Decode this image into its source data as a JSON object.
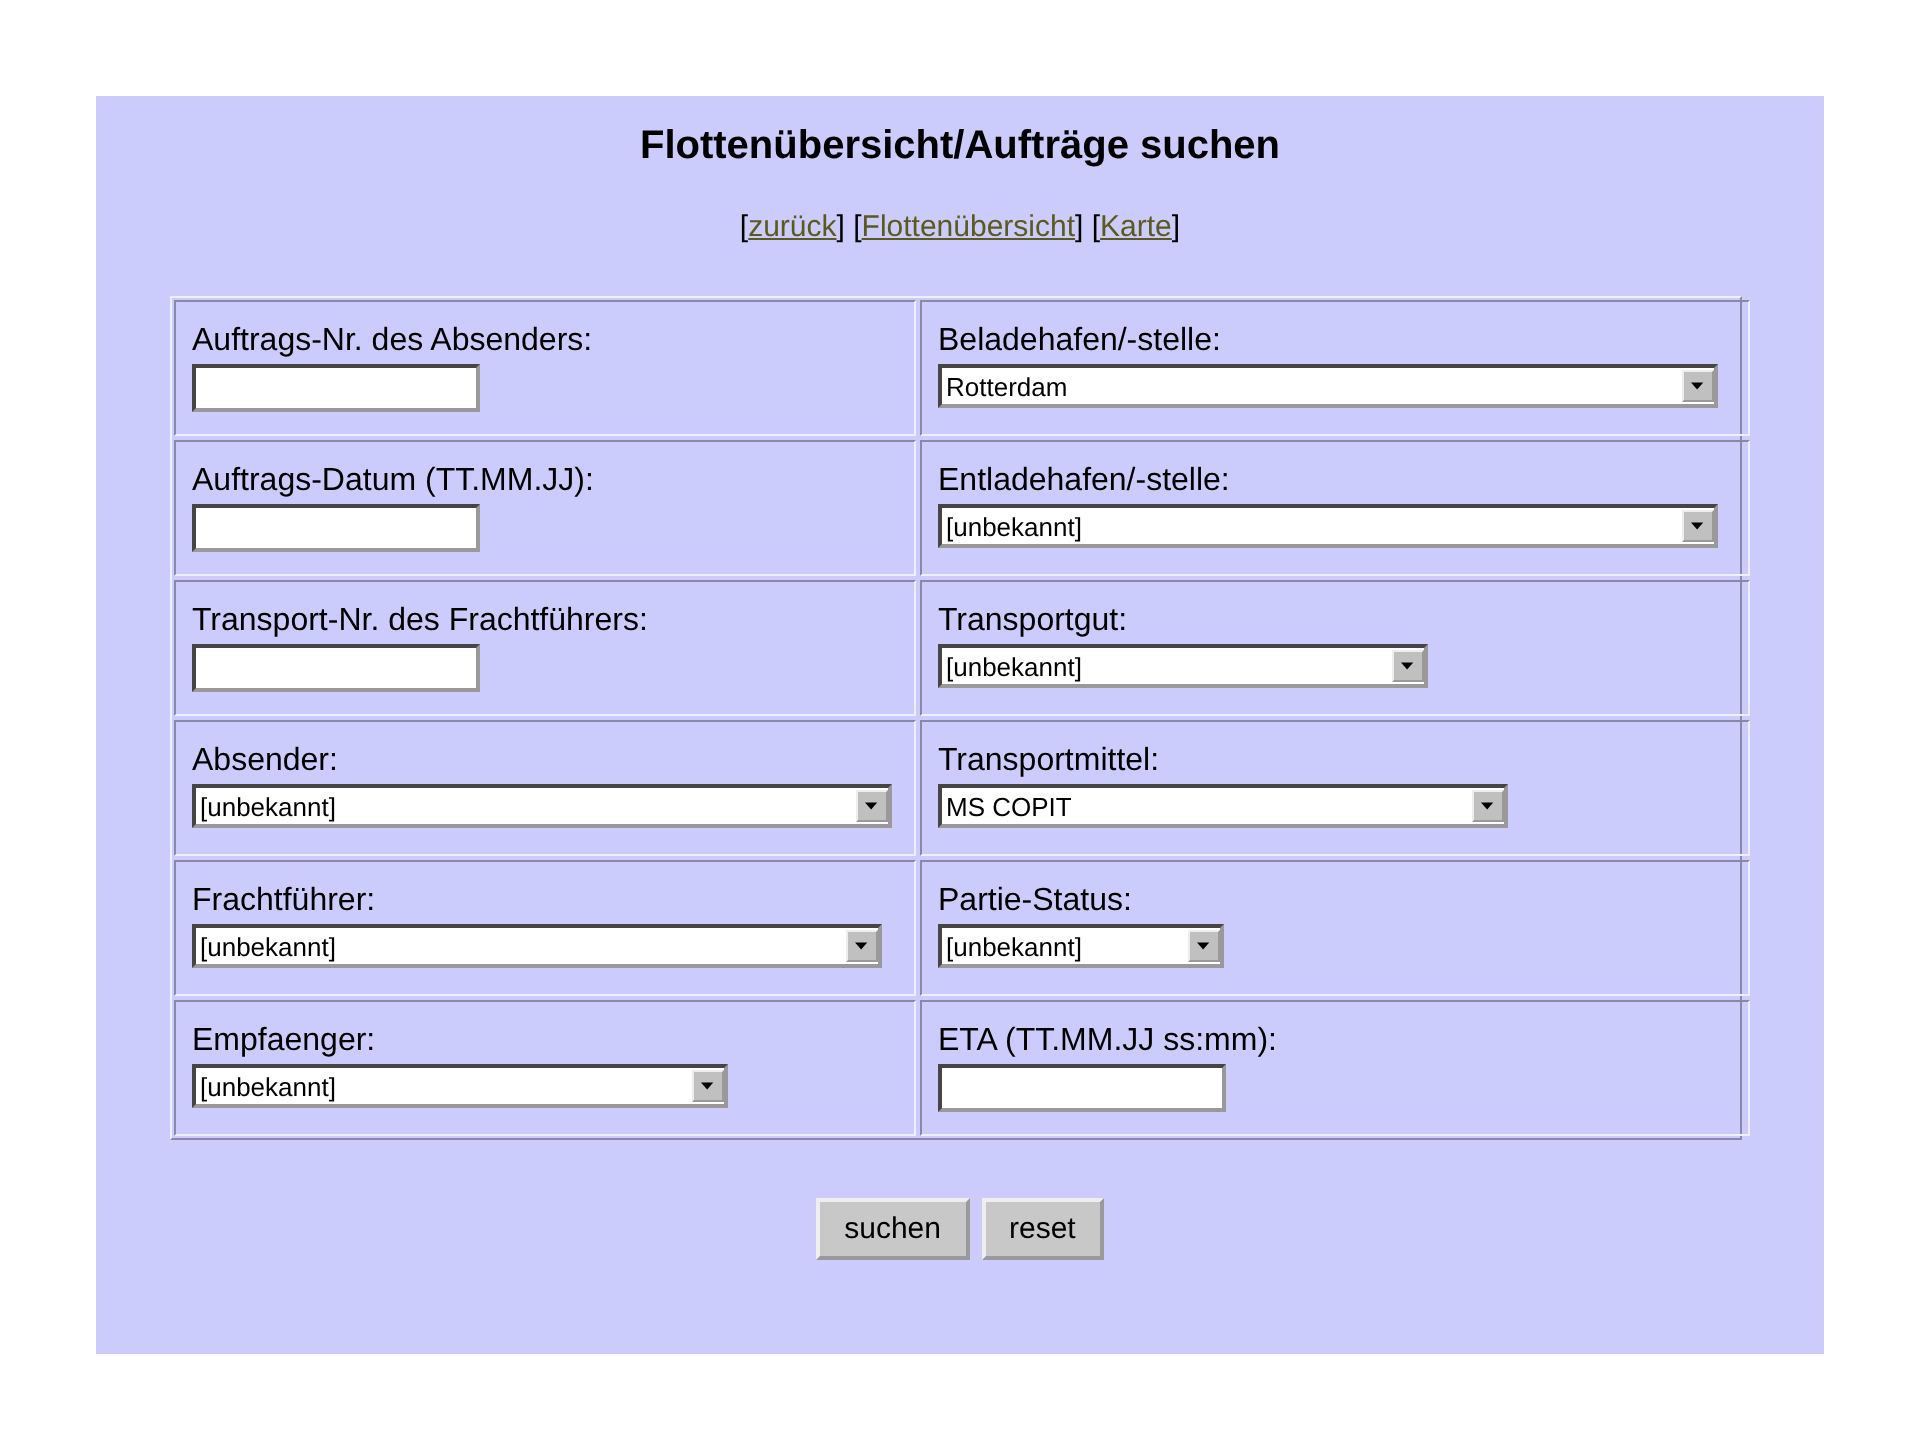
{
  "title": "Flottenübersicht/Aufträge suchen",
  "nav_links": [
    {
      "open": "[",
      "label": "zurück",
      "close": "]"
    },
    {
      "open": "[",
      "label": "Flottenübersicht",
      "close": "]"
    },
    {
      "open": "[",
      "label": "Karte",
      "close": "]"
    }
  ],
  "fields": [
    {
      "label": "Auftrags-Nr. des Absenders:",
      "kind": "text"
    },
    {
      "label": "Beladehafen/-stelle:",
      "kind": "select",
      "value": "Rotterdam"
    },
    {
      "label": "Auftrags-Datum (TT.MM.JJ):",
      "kind": "text"
    },
    {
      "label": "Entladehafen/-stelle:",
      "kind": "select",
      "value": "[unbekannt]"
    },
    {
      "label": "Transport-Nr. des Frachtführers:",
      "kind": "text"
    },
    {
      "label": "Transportgut:",
      "kind": "select",
      "value": "[unbekannt]"
    },
    {
      "label": "Absender:",
      "kind": "select",
      "value": "[unbekannt]"
    },
    {
      "label": "Transportmittel:",
      "kind": "select",
      "value": "MS COPIT"
    },
    {
      "label": "Frachtführer:",
      "kind": "select",
      "value": "[unbekannt]"
    },
    {
      "label": "Partie-Status:",
      "kind": "select",
      "value": "[unbekannt]"
    },
    {
      "label": "Empfaenger:",
      "kind": "select",
      "value": "[unbekannt]"
    },
    {
      "label": "ETA (TT.MM.JJ ss:mm):",
      "kind": "text"
    }
  ],
  "buttons": [
    "suchen",
    "reset"
  ]
}
